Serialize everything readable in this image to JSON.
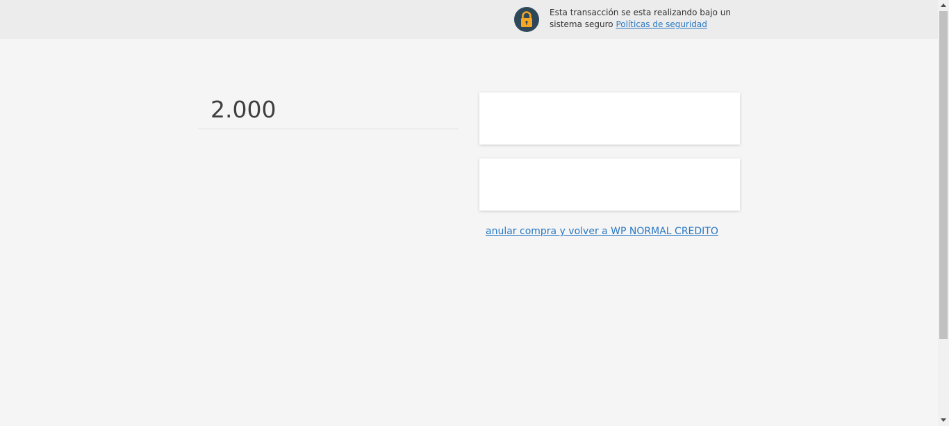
{
  "header": {
    "security_message": "Esta transacción se esta realizando bajo un sistema seguro",
    "policy_link": "Políticas de seguridad",
    "icon": "lock-icon"
  },
  "summary": {
    "amount": "2.000"
  },
  "actions": {
    "cancel_link": "anular compra y volver a WP NORMAL CREDITO"
  },
  "colors": {
    "link": "#2a78c2",
    "lock_circle": "#2f4858",
    "lock_body": "#f5a623"
  }
}
